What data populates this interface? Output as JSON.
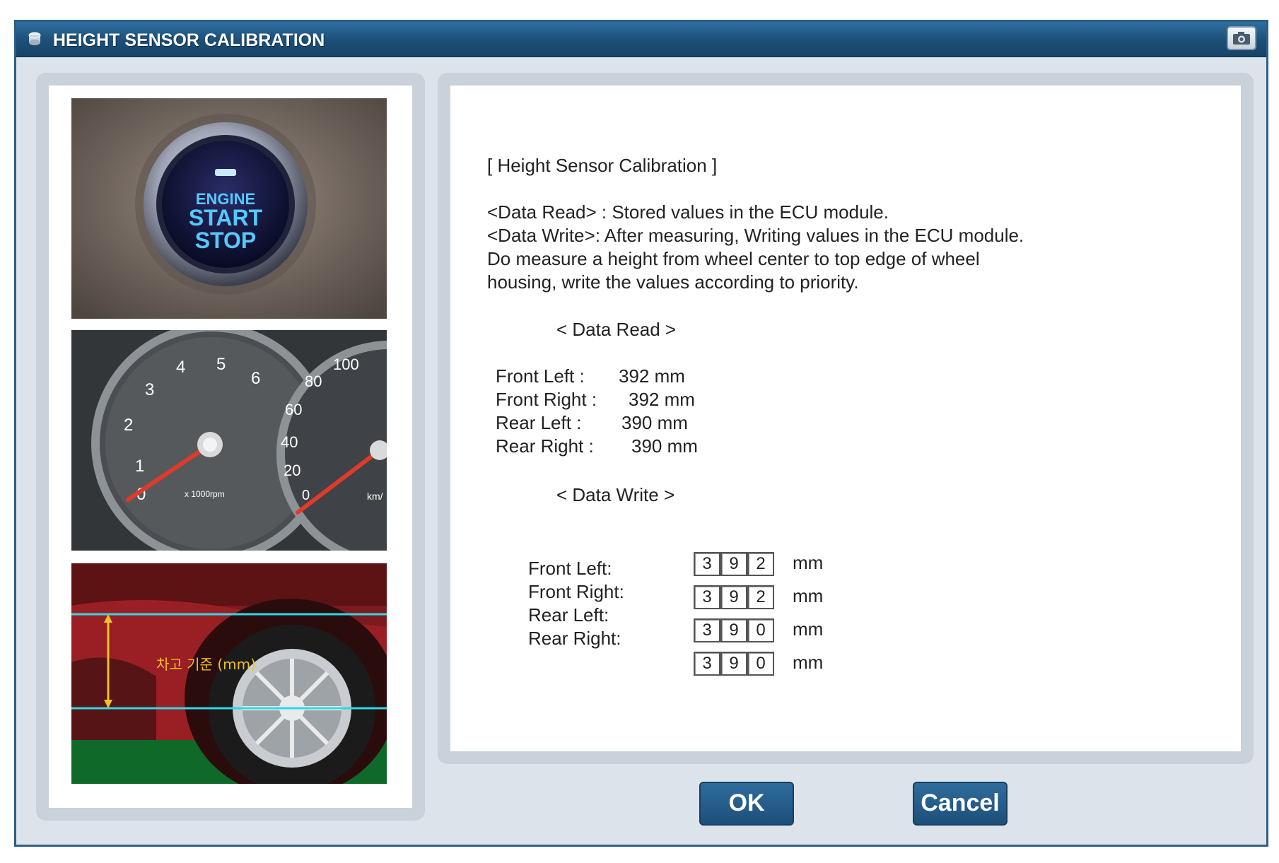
{
  "window": {
    "title": "HEIGHT SENSOR CALIBRATION"
  },
  "photos": {
    "engine_button": {
      "line1": "ENGINE",
      "line2": "START",
      "line3": "STOP"
    },
    "gauge": {
      "tach_ticks": [
        "1",
        "2",
        "3",
        "4",
        "5",
        "6"
      ],
      "tach_zero": "0",
      "tach_unit": "x 1000rpm",
      "speed_ticks": [
        "20",
        "40",
        "60",
        "80",
        "100"
      ],
      "speed_zero": "0",
      "speed_unit": "km/"
    },
    "car_label": "차고 기준 (mm)"
  },
  "content": {
    "heading": "[ Height Sensor Calibration ]",
    "desc_line1": "<Data Read> : Stored values in the ECU module.",
    "desc_line2": "<Data Write>: After measuring, Writing values in the ECU module.",
    "desc_line3": "Do measure a height from wheel center to top edge of wheel",
    "desc_line4": "housing, write the values according to priority.",
    "data_read_title": "< Data Read >",
    "data_read": [
      {
        "label": "Front Left :",
        "value": "392 mm"
      },
      {
        "label": "Front Right :",
        "value": "392 mm"
      },
      {
        "label": "Rear Left :",
        "value": "390 mm"
      },
      {
        "label": "Rear Right :",
        "value": "390 mm"
      }
    ],
    "data_write_title": "< Data Write >",
    "data_write_labels": [
      "Front Left:",
      "Front Right:",
      "Rear Left:",
      "Rear Right:"
    ],
    "data_write": [
      {
        "digits": [
          "3",
          "9",
          "2"
        ],
        "unit": "mm"
      },
      {
        "digits": [
          "3",
          "9",
          "2"
        ],
        "unit": "mm"
      },
      {
        "digits": [
          "3",
          "9",
          "0"
        ],
        "unit": "mm"
      },
      {
        "digits": [
          "3",
          "9",
          "0"
        ],
        "unit": "mm"
      }
    ]
  },
  "buttons": {
    "ok": "OK",
    "cancel": "Cancel"
  },
  "colors": {
    "titlebar": "#1c4f78",
    "button": "#1d4f7a",
    "panel": "#c9d1da"
  }
}
